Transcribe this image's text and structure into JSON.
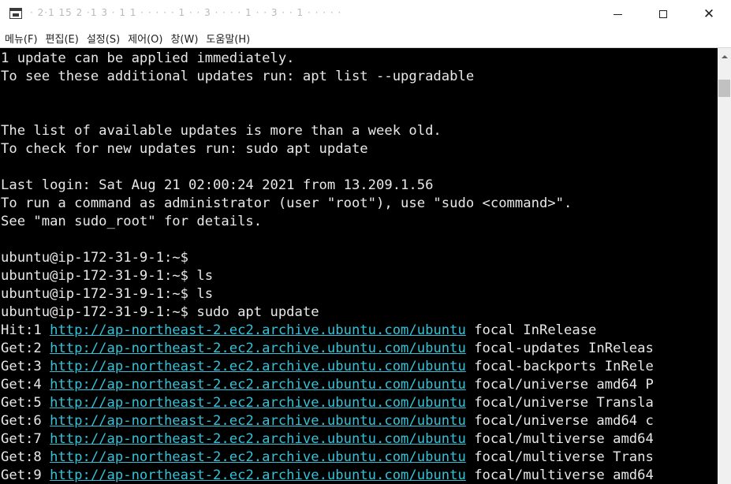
{
  "window": {
    "title": "· 2·1 15 2 ·1 3 · 1 1 · · · · · 1 · · 3 · · · · 1 · · 3 · · 1 · · · · ·",
    "minimize_icon": "minimize-icon",
    "maximize_icon": "maximize-icon",
    "close_icon": "close-icon",
    "close_glyph": "✕"
  },
  "menu": {
    "items": [
      "메뉴(F)",
      "편집(E)",
      "설정(S)",
      "제어(O)",
      "창(W)",
      "도움말(H)"
    ]
  },
  "terminal": {
    "lines": [
      [
        {
          "t": "1 update can be applied immediately."
        }
      ],
      [
        {
          "t": "To see these additional updates run: apt list --upgradable"
        }
      ],
      [
        {
          "t": ""
        }
      ],
      [
        {
          "t": ""
        }
      ],
      [
        {
          "t": "The list of available updates is more than a week old."
        }
      ],
      [
        {
          "t": "To check for new updates run: sudo apt update"
        }
      ],
      [
        {
          "t": ""
        }
      ],
      [
        {
          "t": "Last login: Sat Aug 21 02:00:24 2021 from 13.209.1.56"
        }
      ],
      [
        {
          "t": "To run a command as administrator (user \"root\"), use \"sudo <command>\"."
        }
      ],
      [
        {
          "t": "See \"man sudo_root\" for details."
        }
      ],
      [
        {
          "t": ""
        }
      ],
      [
        {
          "t": "ubuntu@ip-172-31-9-1:~$"
        }
      ],
      [
        {
          "t": "ubuntu@ip-172-31-9-1:~$ ls"
        }
      ],
      [
        {
          "t": "ubuntu@ip-172-31-9-1:~$ ls"
        }
      ],
      [
        {
          "t": "ubuntu@ip-172-31-9-1:~$ sudo apt update"
        }
      ],
      [
        {
          "t": "Hit:1 "
        },
        {
          "t": "http://ap-northeast-2.ec2.archive.ubuntu.com/ubuntu",
          "link": true
        },
        {
          "t": " focal InRelease"
        }
      ],
      [
        {
          "t": "Get:2 "
        },
        {
          "t": "http://ap-northeast-2.ec2.archive.ubuntu.com/ubuntu",
          "link": true
        },
        {
          "t": " focal-updates InReleas"
        }
      ],
      [
        {
          "t": "Get:3 "
        },
        {
          "t": "http://ap-northeast-2.ec2.archive.ubuntu.com/ubuntu",
          "link": true
        },
        {
          "t": " focal-backports InRele"
        }
      ],
      [
        {
          "t": "Get:4 "
        },
        {
          "t": "http://ap-northeast-2.ec2.archive.ubuntu.com/ubuntu",
          "link": true
        },
        {
          "t": " focal/universe amd64 P"
        }
      ],
      [
        {
          "t": "Get:5 "
        },
        {
          "t": "http://ap-northeast-2.ec2.archive.ubuntu.com/ubuntu",
          "link": true
        },
        {
          "t": " focal/universe Transla"
        }
      ],
      [
        {
          "t": "Get:6 "
        },
        {
          "t": "http://ap-northeast-2.ec2.archive.ubuntu.com/ubuntu",
          "link": true
        },
        {
          "t": " focal/universe amd64 c"
        }
      ],
      [
        {
          "t": "Get:7 "
        },
        {
          "t": "http://ap-northeast-2.ec2.archive.ubuntu.com/ubuntu",
          "link": true
        },
        {
          "t": " focal/multiverse amd64"
        }
      ],
      [
        {
          "t": "Get:8 "
        },
        {
          "t": "http://ap-northeast-2.ec2.archive.ubuntu.com/ubuntu",
          "link": true
        },
        {
          "t": " focal/multiverse Trans"
        }
      ],
      [
        {
          "t": "Get:9 "
        },
        {
          "t": "http://ap-northeast-2.ec2.archive.ubuntu.com/ubuntu",
          "link": true
        },
        {
          "t": " focal/multiverse amd64"
        }
      ]
    ]
  },
  "scrollbar": {
    "up_icon": "scroll-up-arrow-icon"
  },
  "colors": {
    "terminal_bg": "#000000",
    "terminal_fg": "#e8e8e8",
    "link": "#34c2d8"
  }
}
